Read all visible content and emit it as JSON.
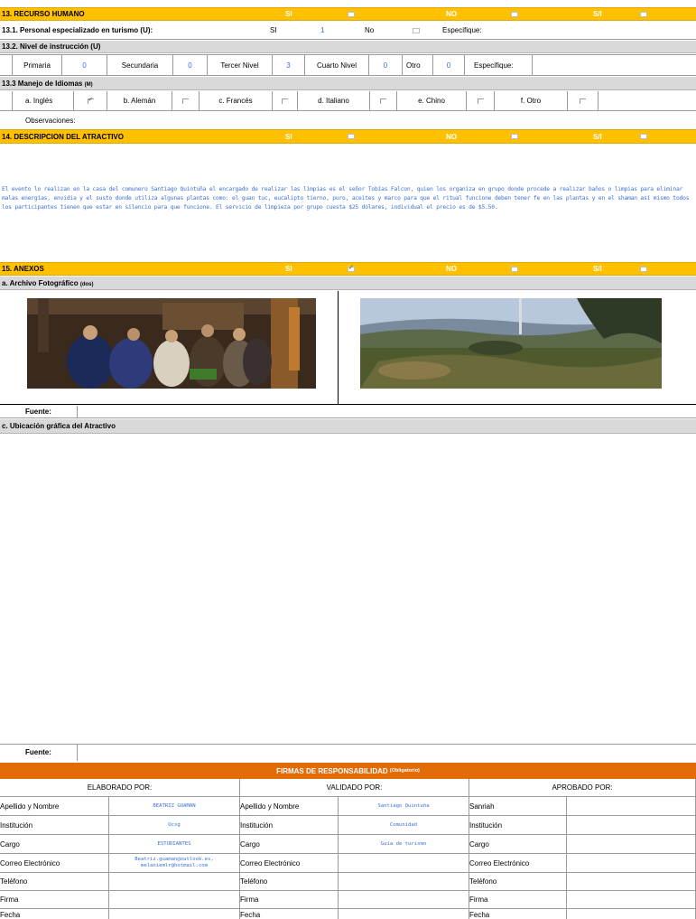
{
  "s13": {
    "title": "13. RECURSO HUMANO",
    "si": "SI",
    "no": "NO",
    "sn": "S/I"
  },
  "s131": {
    "label": "13.1. Personal especializado en turismo",
    "code": "(U):",
    "si": "SI",
    "si_value": "1",
    "no": "No",
    "especifique": "Especifique:"
  },
  "s132": {
    "label": "13.2. Nivel de instrucción",
    "code": "(U)",
    "items": [
      {
        "label": "Primaria",
        "value": "0"
      },
      {
        "label": "Secundaria",
        "value": "0"
      },
      {
        "label": "Tercer Nivel",
        "value": "3"
      },
      {
        "label": "Cuarto Nivel",
        "value": "0"
      },
      {
        "label": "Otro",
        "value": "0"
      }
    ],
    "especifique": "Especifique:"
  },
  "s133": {
    "label": "13.3 Manejo de Idiomas",
    "code": "(M)",
    "items": [
      {
        "label": "a. Inglés",
        "checked": true
      },
      {
        "label": "b. Alemán",
        "checked": false
      },
      {
        "label": "c. Francés",
        "checked": false
      },
      {
        "label": "d. Italiano",
        "checked": false
      },
      {
        "label": "e. Chino",
        "checked": false
      },
      {
        "label": "f. Otro",
        "checked": false
      }
    ],
    "observaciones": "Observaciones:"
  },
  "s14": {
    "title": "14. DESCRIPCION DEL ATRACTIVO",
    "si": "SI",
    "no": "NO",
    "sn": "S/I",
    "text": "El evento lo realizan en la casa del comunero Santiago Quintuña el encargado de realizar las limpias es el señor Tobías Falcon, quien los organiza en grupo donde procede a realizar baños o limpias para eliminar malas energías, envidia y el susto donde utiliza algunas plantas como: el guan tuc, eucalipto tierno, puro, aceites y marco para que el ritual funcione deben tener fe en las plantas y en el shaman así mismo todos los participantes tienen que estar en silencio para que funcione. El servicio de limpieza por grupo cuesta $25 dólares, individual el precio es de $5.50."
  },
  "s15": {
    "title": "15. ANEXOS",
    "si": "SI",
    "no": "NO",
    "sn": "S/I",
    "archivo": "a. Archivo Fotográfico",
    "archivo_code": "(dos)",
    "fuente1": "Fuente:",
    "ubicacion": "c. Ubicación gráfica del Atractivo",
    "fuente2": "Fuente:"
  },
  "firmas": {
    "title": "FIRMAS DE RESPONSABILIDAD",
    "title_note": "(Obligatorio)",
    "elaborado": "ELABORADO POR:",
    "validado": "VALIDADO  POR:",
    "aprobado": "APROBADO POR:",
    "rows": [
      "Apellido y Nombre",
      "Institución",
      "Cargo",
      "Correo Electrónico",
      "Teléfono",
      "Firma",
      "Fecha"
    ],
    "aprobado_first_label": "Sanriah",
    "elaborado_values": [
      "BEATRIZ GUAMAN",
      "Ucsg",
      "ESTUDIANTES",
      "Beatriz.guaman@outlook.es,\nmelaniemlr@hotmail.com",
      "",
      "",
      ""
    ],
    "validado_values": [
      "Santiago Quintuña",
      "Comunidad",
      "Guia de turismo",
      "",
      "",
      "",
      ""
    ]
  },
  "colors": {
    "yellow": "#ffc000",
    "gray": "#d9d9d9",
    "orange": "#e26b0a",
    "blue": "#3a6fd8"
  }
}
